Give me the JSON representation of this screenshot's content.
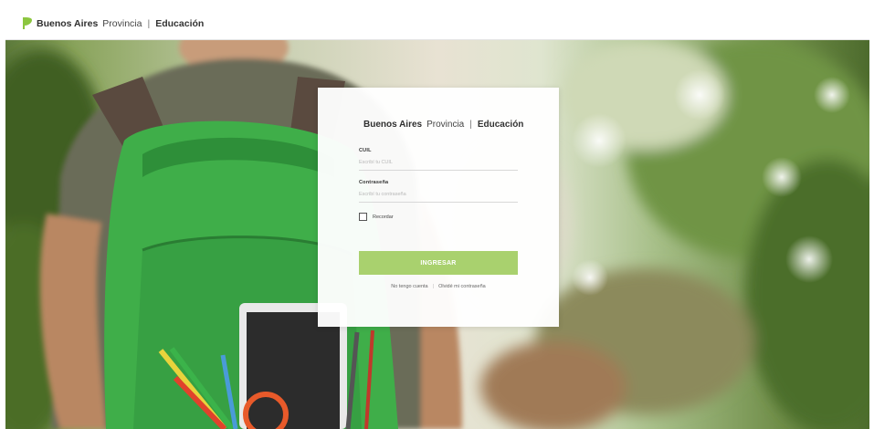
{
  "header": {
    "brand_bold": "Buenos Aires",
    "brand_regular": "Provincia",
    "brand_separator": "|",
    "brand_dept": "Educación"
  },
  "login": {
    "brand_bold": "Buenos Aires",
    "brand_regular": "Provincia",
    "brand_separator": "|",
    "brand_dept": "Educación",
    "cuil_label": "CUIL",
    "cuil_placeholder": "Escribí tu CUIL",
    "cuil_value": "",
    "password_label": "Contraseña",
    "password_placeholder": "Escribí tu contraseña",
    "password_value": "",
    "remember_label": "Recordar",
    "remember_checked": false,
    "submit_label": "INGRESAR",
    "no_account_link": "No tengo cuenta",
    "links_separator": "|",
    "forgot_password_link": "Olvidé mi contraseña"
  },
  "colors": {
    "brand_green": "#8cc63f",
    "button_green": "#a9d16e",
    "background_photo_tone": "#8aa45c"
  },
  "icons": {
    "brand_logo": "leaf-icon",
    "remember_box": "checkbox-icon"
  }
}
